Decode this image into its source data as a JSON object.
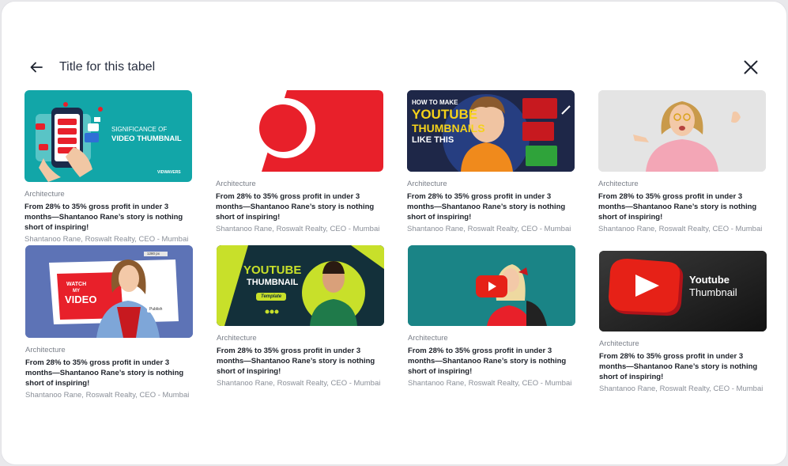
{
  "header": {
    "title": "Title for this tabel"
  },
  "thumb_text": {
    "c1": {
      "line1": "SIGNIFICANCE OF",
      "line2": "VIDEO THUMBNAIL",
      "brand": "VIDWAVERS"
    },
    "c3": {
      "line1": "HOW TO MAKE",
      "line2": "YOUTUBE",
      "line3": "THUMBNAILS",
      "line4": "LIKE THIS"
    },
    "c5": {
      "watch": "WATCH",
      "my": "MY",
      "video": "VIDEO",
      "dim": "1280 px",
      "publish": "Publish"
    },
    "c6": {
      "line1": "YOUTUBE",
      "line2": "THUMBNAIL",
      "tag": "Template"
    },
    "c8": {
      "line1": "Youtube",
      "line2": "Thumbnail"
    }
  },
  "cards": [
    {
      "category": "Architecture",
      "headline": "From 28% to 35% gross profit in under 3 months—Shantanoo Rane’s story is nothing short of inspiring!",
      "author": "Shantanoo Rane, Roswalt Realty, CEO - Mumbai"
    },
    {
      "category": "Architecture",
      "headline": "From 28% to 35% gross profit in under 3 months—Shantanoo Rane’s story is nothing short of inspiring!",
      "author": "Shantanoo Rane, Roswalt Realty, CEO - Mumbai"
    },
    {
      "category": "Architecture",
      "headline": "From 28% to 35% gross profit in under 3 months—Shantanoo Rane’s story is nothing short of inspiring!",
      "author": "Shantanoo Rane, Roswalt Realty, CEO - Mumbai"
    },
    {
      "category": "Architecture",
      "headline": "From 28% to 35% gross profit in under 3 months—Shantanoo Rane’s story is nothing short of inspiring!",
      "author": "Shantanoo Rane, Roswalt Realty, CEO - Mumbai"
    },
    {
      "category": "Architecture",
      "headline": "From 28% to 35% gross profit in under 3 months—Shantanoo Rane’s story is nothing short of inspiring!",
      "author": "Shantanoo Rane, Roswalt Realty, CEO - Mumbai"
    },
    {
      "category": "Architecture",
      "headline": "From 28% to 35% gross profit in under 3 months—Shantanoo Rane’s story is nothing short of inspiring!",
      "author": "Shantanoo Rane, Roswalt Realty, CEO - Mumbai"
    },
    {
      "category": "Architecture",
      "headline": "From 28% to 35% gross profit in under 3 months—Shantanoo Rane’s story is nothing short of inspiring!",
      "author": "Shantanoo Rane, Roswalt Realty, CEO - Mumbai"
    },
    {
      "category": "Architecture",
      "headline": "From 28% to 35% gross profit in under 3 months—Shantanoo Rane’s story is nothing short of inspiring!",
      "author": "Shantanoo Rane, Roswalt Realty, CEO - Mumbai"
    }
  ],
  "colors": {
    "red": "#e8202a",
    "teal": "#12a6a8",
    "youtube_red": "#e62117",
    "lime": "#c8e02a"
  }
}
